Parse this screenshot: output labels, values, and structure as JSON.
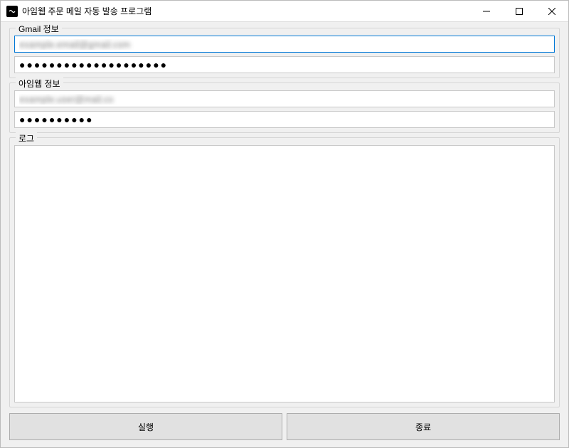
{
  "window": {
    "title": "아임웹 주문 메일 자동 발송 프로그램"
  },
  "gmail_section": {
    "title": "Gmail 정보",
    "email_value": "example.email@gmail.com",
    "password_value": "●●●●●●●●●●●●●●●●●●●●"
  },
  "imweb_section": {
    "title": "아임웹 정보",
    "email_value": "example.user@mail.co",
    "password_value": "●●●●●●●●●●"
  },
  "log_section": {
    "title": "로그",
    "content": ""
  },
  "buttons": {
    "run": "실행",
    "exit": "종료"
  }
}
